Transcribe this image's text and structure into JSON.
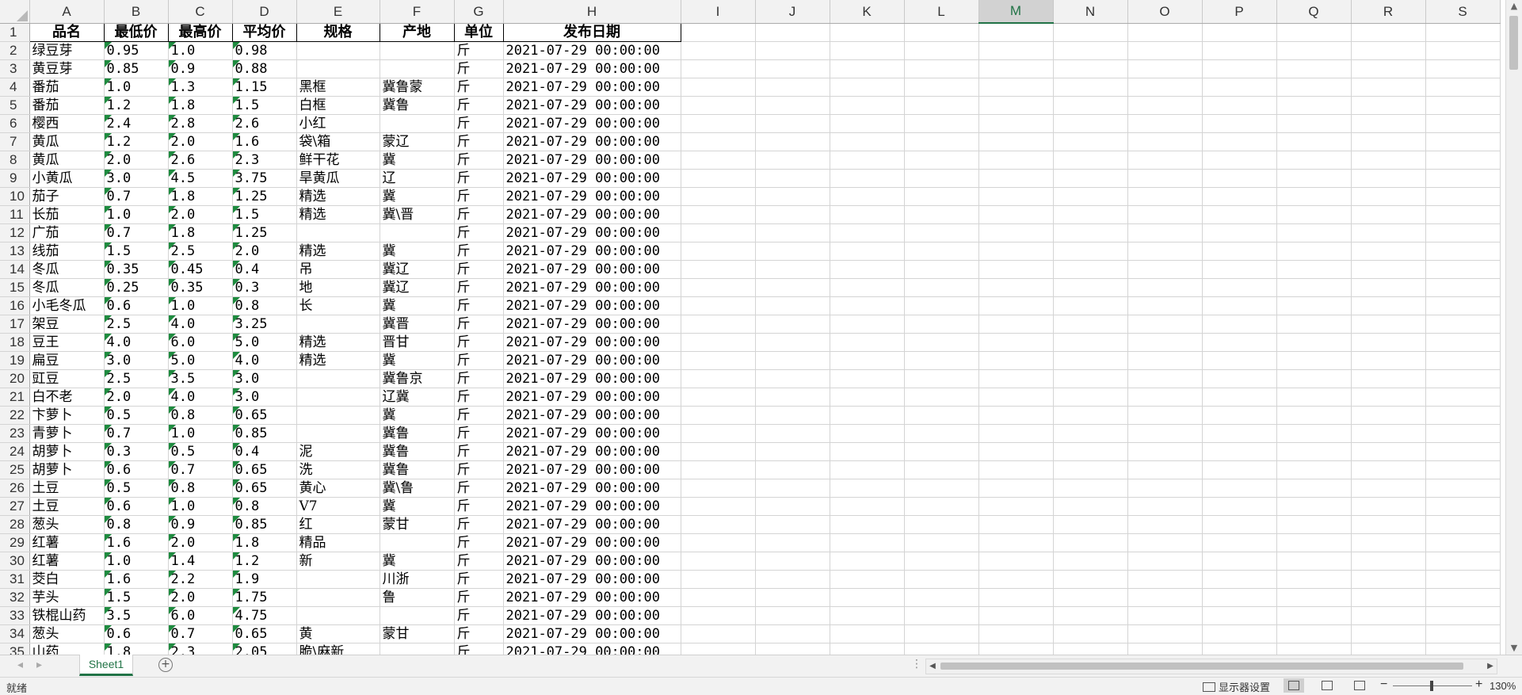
{
  "columns": [
    "A",
    "B",
    "C",
    "D",
    "E",
    "F",
    "G",
    "H",
    "I",
    "J",
    "K",
    "L",
    "M",
    "N",
    "O",
    "P",
    "Q",
    "R",
    "S"
  ],
  "selected_column": "M",
  "headers": [
    "品名",
    "最低价",
    "最高价",
    "平均价",
    "规格",
    "产地",
    "单位",
    "发布日期"
  ],
  "rows": [
    [
      "绿豆芽",
      "0.95",
      "1.0",
      "0.98",
      "",
      "",
      "斤",
      "2021-07-29 00:00:00"
    ],
    [
      "黄豆芽",
      "0.85",
      "0.9",
      "0.88",
      "",
      "",
      "斤",
      "2021-07-29 00:00:00"
    ],
    [
      "番茄",
      "1.0",
      "1.3",
      "1.15",
      "黑框",
      "冀鲁蒙",
      "斤",
      "2021-07-29 00:00:00"
    ],
    [
      "番茄",
      "1.2",
      "1.8",
      "1.5",
      "白框",
      "冀鲁",
      "斤",
      "2021-07-29 00:00:00"
    ],
    [
      "樱西",
      "2.4",
      "2.8",
      "2.6",
      "小红",
      "",
      "斤",
      "2021-07-29 00:00:00"
    ],
    [
      "黄瓜",
      "1.2",
      "2.0",
      "1.6",
      "袋\\箱",
      "蒙辽",
      "斤",
      "2021-07-29 00:00:00"
    ],
    [
      "黄瓜",
      "2.0",
      "2.6",
      "2.3",
      "鲜干花",
      "冀",
      "斤",
      "2021-07-29 00:00:00"
    ],
    [
      "小黄瓜",
      "3.0",
      "4.5",
      "3.75",
      "旱黄瓜",
      "辽",
      "斤",
      "2021-07-29 00:00:00"
    ],
    [
      "茄子",
      "0.7",
      "1.8",
      "1.25",
      "精选",
      "冀",
      "斤",
      "2021-07-29 00:00:00"
    ],
    [
      "长茄",
      "1.0",
      "2.0",
      "1.5",
      "精选",
      "冀\\晋",
      "斤",
      "2021-07-29 00:00:00"
    ],
    [
      "广茄",
      "0.7",
      "1.8",
      "1.25",
      "",
      "",
      "斤",
      "2021-07-29 00:00:00"
    ],
    [
      "线茄",
      "1.5",
      "2.5",
      "2.0",
      "精选",
      "冀",
      "斤",
      "2021-07-29 00:00:00"
    ],
    [
      "冬瓜",
      "0.35",
      "0.45",
      "0.4",
      "吊",
      "冀辽",
      "斤",
      "2021-07-29 00:00:00"
    ],
    [
      "冬瓜",
      "0.25",
      "0.35",
      "0.3",
      "地",
      "冀辽",
      "斤",
      "2021-07-29 00:00:00"
    ],
    [
      "小毛冬瓜",
      "0.6",
      "1.0",
      "0.8",
      "长",
      "冀",
      "斤",
      "2021-07-29 00:00:00"
    ],
    [
      "架豆",
      "2.5",
      "4.0",
      "3.25",
      "",
      "冀晋",
      "斤",
      "2021-07-29 00:00:00"
    ],
    [
      "豆王",
      "4.0",
      "6.0",
      "5.0",
      "精选",
      "晋甘",
      "斤",
      "2021-07-29 00:00:00"
    ],
    [
      "扁豆",
      "3.0",
      "5.0",
      "4.0",
      "精选",
      "冀",
      "斤",
      "2021-07-29 00:00:00"
    ],
    [
      "豇豆",
      "2.5",
      "3.5",
      "3.0",
      "",
      "冀鲁京",
      "斤",
      "2021-07-29 00:00:00"
    ],
    [
      "白不老",
      "2.0",
      "4.0",
      "3.0",
      "",
      "辽冀",
      "斤",
      "2021-07-29 00:00:00"
    ],
    [
      "卞萝卜",
      "0.5",
      "0.8",
      "0.65",
      "",
      "冀",
      "斤",
      "2021-07-29 00:00:00"
    ],
    [
      "青萝卜",
      "0.7",
      "1.0",
      "0.85",
      "",
      "冀鲁",
      "斤",
      "2021-07-29 00:00:00"
    ],
    [
      "胡萝卜",
      "0.3",
      "0.5",
      "0.4",
      "泥",
      "冀鲁",
      "斤",
      "2021-07-29 00:00:00"
    ],
    [
      "胡萝卜",
      "0.6",
      "0.7",
      "0.65",
      "洗",
      "冀鲁",
      "斤",
      "2021-07-29 00:00:00"
    ],
    [
      "土豆",
      "0.5",
      "0.8",
      "0.65",
      "黄心",
      "冀\\鲁",
      "斤",
      "2021-07-29 00:00:00"
    ],
    [
      "土豆",
      "0.6",
      "1.0",
      "0.8",
      "V7",
      "冀",
      "斤",
      "2021-07-29 00:00:00"
    ],
    [
      "葱头",
      "0.8",
      "0.9",
      "0.85",
      "红",
      "蒙甘",
      "斤",
      "2021-07-29 00:00:00"
    ],
    [
      "红薯",
      "1.6",
      "2.0",
      "1.8",
      "精品",
      "",
      "斤",
      "2021-07-29 00:00:00"
    ],
    [
      "红薯",
      "1.0",
      "1.4",
      "1.2",
      "新",
      "冀",
      "斤",
      "2021-07-29 00:00:00"
    ],
    [
      "茭白",
      "1.6",
      "2.2",
      "1.9",
      "",
      "川浙",
      "斤",
      "2021-07-29 00:00:00"
    ],
    [
      "芋头",
      "1.5",
      "2.0",
      "1.75",
      "",
      "鲁",
      "斤",
      "2021-07-29 00:00:00"
    ],
    [
      "铁棍山药",
      "3.5",
      "6.0",
      "4.75",
      "",
      "",
      "斤",
      "2021-07-29 00:00:00"
    ],
    [
      "葱头",
      "0.6",
      "0.7",
      "0.65",
      "黄",
      "蒙甘",
      "斤",
      "2021-07-29 00:00:00"
    ],
    [
      "山药",
      "1.8",
      "2.3",
      "2.05",
      "脆\\麻新",
      "",
      "斤",
      "2021-07-29 00:00:00"
    ]
  ],
  "sheet_tab": "Sheet1",
  "status": {
    "ready": "就绪",
    "display_settings": "显示器设置",
    "zoom": "130%"
  },
  "colors": {
    "accent": "#217346",
    "error_marker": "#1e8b3f"
  }
}
